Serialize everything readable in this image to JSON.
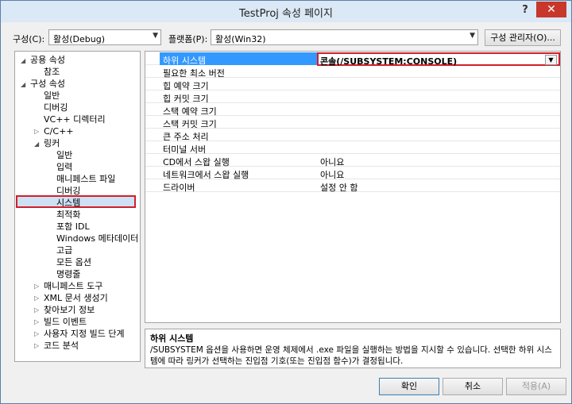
{
  "window": {
    "title": "TestProj 속성 페이지",
    "help": "?",
    "close": "✕"
  },
  "toolbar": {
    "config_label": "구성(C):",
    "config_value": "활성(Debug)",
    "platform_label": "플랫폼(P):",
    "platform_value": "활성(Win32)",
    "config_manager": "구성 관리자(O)..."
  },
  "tree": [
    "공용 속성",
    "참조",
    "구성 속성",
    "일반",
    "디버깅",
    "VC++ 디렉터리",
    "C/C++",
    "링커",
    "일반",
    "입력",
    "매니페스트 파일",
    "디버깅",
    "시스템",
    "최적화",
    "포함 IDL",
    "Windows 메타데이터",
    "고급",
    "모든 옵션",
    "명령줄",
    "매니페스트 도구",
    "XML 문서 생성기",
    "찾아보기 정보",
    "빌드 이벤트",
    "사용자 지정 빌드 단계",
    "코드 분석"
  ],
  "grid": {
    "rows": [
      {
        "name": "하위 시스템",
        "value": "콘솔(/SUBSYSTEM:CONSOLE)"
      },
      {
        "name": "필요한 최소 버전",
        "value": ""
      },
      {
        "name": "힙 예약 크기",
        "value": ""
      },
      {
        "name": "힙 커밋 크기",
        "value": ""
      },
      {
        "name": "스택 예약 크기",
        "value": ""
      },
      {
        "name": "스택 커밋 크기",
        "value": ""
      },
      {
        "name": "큰 주소 처리",
        "value": ""
      },
      {
        "name": "터미널 서버",
        "value": ""
      },
      {
        "name": "CD에서 스왑 실행",
        "value": "아니요"
      },
      {
        "name": "네트워크에서 스왑 실행",
        "value": "아니요"
      },
      {
        "name": "드라이버",
        "value": "설정 안 함"
      }
    ]
  },
  "description": {
    "title": "하위 시스템",
    "text": "/SUBSYSTEM 옵션을 사용하면 운영 체제에서 .exe 파일을 실행하는 방법을 지시할 수 있습니다. 선택한 하위 시스템에 따라 링커가 선택하는 진입점 기호(또는 진입점 함수)가 결정됩니다."
  },
  "buttons": {
    "ok": "확인",
    "cancel": "취소",
    "apply": "적용(A)"
  },
  "colors": {
    "selection": "#3399ff",
    "highlight_border": "#d0202a",
    "close": "#c7372a"
  }
}
